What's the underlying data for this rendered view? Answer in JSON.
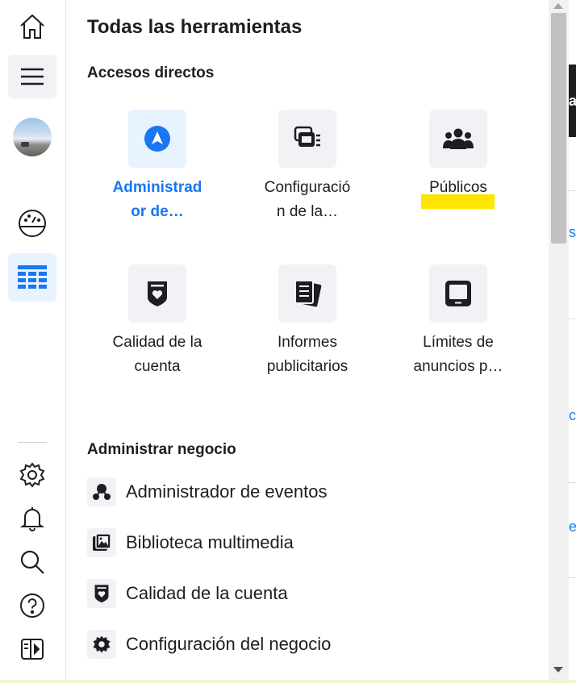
{
  "rail": {
    "items": [
      {
        "name": "home-icon"
      },
      {
        "name": "menu-icon"
      },
      {
        "name": "account-avatar"
      },
      {
        "name": "dashboard-gauge-icon"
      },
      {
        "name": "all-tools-grid-icon"
      },
      {
        "name": "settings-gear-icon"
      },
      {
        "name": "notifications-bell-icon"
      },
      {
        "name": "search-icon"
      },
      {
        "name": "help-icon"
      },
      {
        "name": "collapse-panel-icon"
      }
    ]
  },
  "panel": {
    "title": "Todas las herramientas",
    "shortcuts": {
      "title": "Accesos directos",
      "tiles": [
        {
          "line1": "Administrad",
          "line2": "or de…",
          "icon": "navigation-arrow-icon",
          "selected": true
        },
        {
          "line1": "Configuració",
          "line2": "n de la…",
          "icon": "ad-settings-icon",
          "selected": false
        },
        {
          "line1": "Públicos",
          "line2": "",
          "icon": "audiences-people-icon",
          "selected": false
        },
        {
          "line1": "Calidad de la",
          "line2": "cuenta",
          "icon": "account-quality-shield-icon",
          "selected": false
        },
        {
          "line1": "Informes",
          "line2": "publicitarios",
          "icon": "ads-reports-icon",
          "selected": false
        },
        {
          "line1": "Límites de",
          "line2": "anuncios p…",
          "icon": "ad-limits-tablet-icon",
          "selected": false
        }
      ]
    },
    "business": {
      "title": "Administrar negocio",
      "items": [
        {
          "label": "Administrador de eventos",
          "icon": "events-manager-icon"
        },
        {
          "label": "Biblioteca multimedia",
          "icon": "media-library-icon"
        },
        {
          "label": "Calidad de la cuenta",
          "icon": "account-quality-shield-icon"
        },
        {
          "label": "Configuración del negocio",
          "icon": "business-settings-gear-icon"
        }
      ]
    }
  },
  "edge": {
    "fragment_1": "a",
    "fragment_2": "s",
    "fragment_3": "c",
    "fragment_4": "e"
  },
  "colors": {
    "accent": "#1877f2",
    "highlight": "#ffe600",
    "tile_bg": "#f0f2f5",
    "selected_bg": "#e7f3ff"
  }
}
